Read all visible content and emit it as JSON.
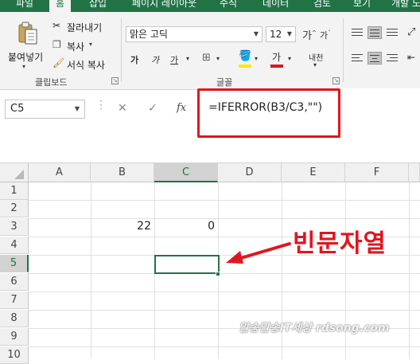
{
  "ribbon_tabs": [
    "파일",
    "홈",
    "삽입",
    "페이지 레이아웃",
    "수식",
    "데이터",
    "검토",
    "보기",
    "개발 도"
  ],
  "clipboard": {
    "paste_label": "붙여넣기",
    "cut_label": "잘라내기",
    "copy_label": "복사",
    "format_painter_label": "서식 복사",
    "group_label": "클립보드"
  },
  "font": {
    "font_name": "맑은 고딕",
    "font_size": "12",
    "bold_label": "가",
    "italic_label": "가",
    "underline_label": "가",
    "grow_label": "가",
    "shrink_label": "가",
    "font_color_label": "가",
    "phonetic_label": "내천",
    "group_label": "글꼴"
  },
  "formula_bar": {
    "name_box": "C5",
    "cancel_symbol": "✕",
    "enter_symbol": "✓",
    "fx_symbol": "fx",
    "formula": "=IFERROR(B3/C3,\"\")"
  },
  "sheet": {
    "columns": [
      "A",
      "B",
      "C",
      "D",
      "E",
      "F"
    ],
    "rows": [
      "1",
      "2",
      "3",
      "4",
      "5",
      "6",
      "7",
      "8",
      "9",
      "10"
    ],
    "cells": {
      "B3": "22",
      "C3": "0"
    },
    "selected_cell": "C5"
  },
  "annotation": {
    "text": "빈문자열",
    "color": "#e0161e"
  },
  "watermark": "알송달송IT세상 rdsong.com",
  "colors": {
    "excel_green": "#217346",
    "highlight_red": "#e0161e"
  }
}
